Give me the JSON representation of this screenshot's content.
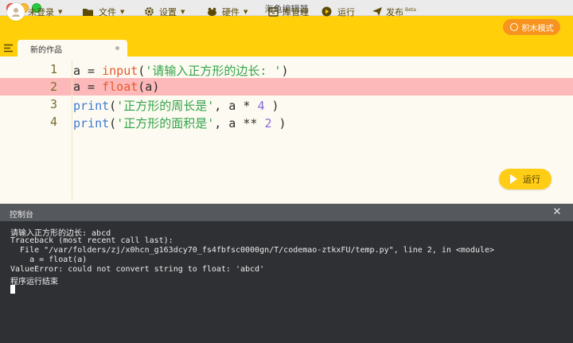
{
  "window": {
    "title": "海龟编辑器"
  },
  "toolbar": {
    "login_label": "未登录",
    "file_label": "文件",
    "settings_label": "设置",
    "hardware_label": "硬件",
    "library_label": "库管理",
    "run_label": "运行",
    "publish_label": "发布",
    "publish_badge": "Beta",
    "block_mode_label": "积木模式"
  },
  "tabs": [
    {
      "label": "新的作品"
    }
  ],
  "editor": {
    "lines": [
      {
        "number": "1",
        "text": "a = input('请输入正方形的边长: ')"
      },
      {
        "number": "2",
        "text": "a = float(a)"
      },
      {
        "number": "3",
        "text": "print('正方形的周长是', a * 4 )"
      },
      {
        "number": "4",
        "text": "print('正方形的面积是', a ** 2 )"
      }
    ],
    "highlighted_line": 2,
    "run_button_label": "运行"
  },
  "console": {
    "title": "控制台",
    "lines": [
      "请输入正方形的边长: abcd",
      "Traceback (most recent call last):",
      "  File \"/var/folders/zj/x0hcn_g163dcy70_fs4fbfsc0000gn/T/codemao-ztkxFU/temp.py\", line 2, in <module>",
      "    a = float(a)",
      "ValueError: could not convert string to float: 'abcd'",
      "程序运行结束"
    ]
  },
  "colors": {
    "toolbar": "#ffcf0a",
    "editor_bg": "#fdfbf1",
    "error_highlight": "#fdb9b9",
    "console_bg": "#2e3033",
    "block_mode_button": "#f7931e"
  }
}
